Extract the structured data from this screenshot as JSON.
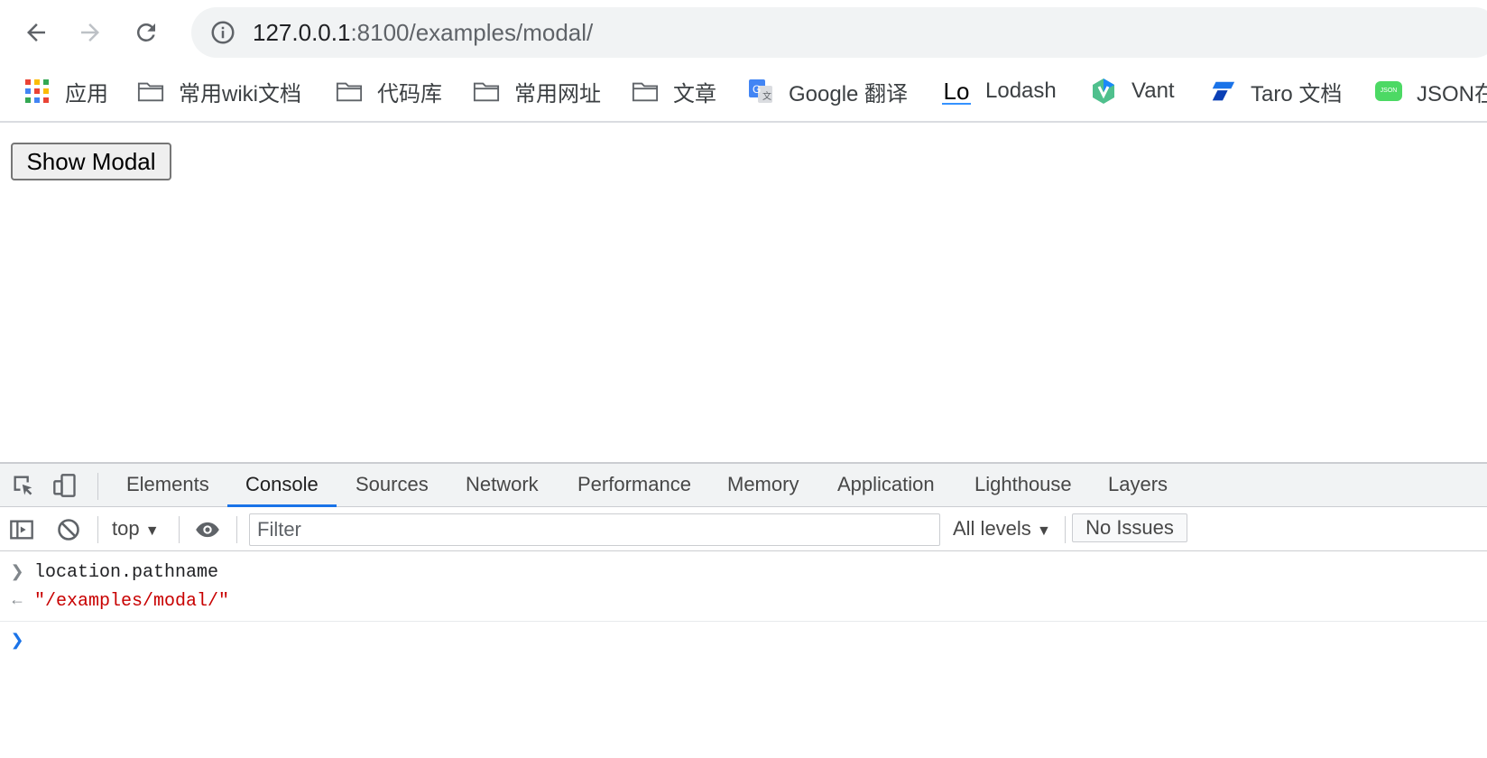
{
  "browser": {
    "url_host": "127.0.0.1",
    "url_rest": ":8100/examples/modal/"
  },
  "bookmarks": [
    {
      "label": "应用",
      "icon": "apps-grid-icon"
    },
    {
      "label": "常用wiki文档",
      "icon": "folder-icon"
    },
    {
      "label": "代码库",
      "icon": "folder-icon"
    },
    {
      "label": "常用网址",
      "icon": "folder-icon"
    },
    {
      "label": "文章",
      "icon": "folder-icon"
    },
    {
      "label": "Google 翻译",
      "icon": "google-translate-icon"
    },
    {
      "label": "Lodash",
      "icon": "lodash-icon",
      "icon_text": "Lo"
    },
    {
      "label": "Vant",
      "icon": "vant-icon"
    },
    {
      "label": "Taro 文档",
      "icon": "taro-icon"
    },
    {
      "label": "JSON在",
      "icon": "json-icon",
      "icon_text": "JSON"
    }
  ],
  "page": {
    "show_modal_label": "Show Modal"
  },
  "devtools": {
    "tabs": [
      "Elements",
      "Console",
      "Sources",
      "Network",
      "Performance",
      "Memory",
      "Application",
      "Lighthouse",
      "Layers"
    ],
    "active_tab": "Console",
    "context": "top",
    "filter_placeholder": "Filter",
    "levels": "All levels",
    "issues": "No Issues",
    "console": {
      "input": "location.pathname",
      "output": "\"/examples/modal/\""
    }
  },
  "colors": {
    "accent": "#1a73e8",
    "string": "#c80000"
  }
}
